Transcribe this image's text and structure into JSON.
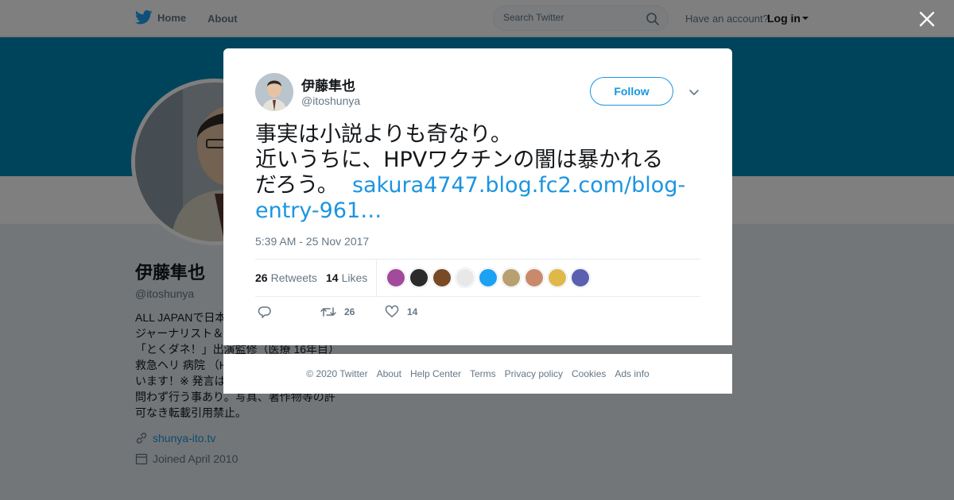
{
  "nav": {
    "home_label": "Home",
    "about_label": "About",
    "search_placeholder": "Search Twitter",
    "account_prompt": "Have an account?",
    "login_label": "Log in"
  },
  "profile": {
    "name": "伊藤隼也",
    "handle": "@itoshunya",
    "bio": "ALL JAPANで日本の医療を変える！医療ジャーナリスト＆写真家。フジテレビ「とくダネ！」出演監修（医療 16年目） 救急ヘリ 病院 （HEM-Net）より……ています！※ 発言は私的呟きでRTは賛否を問わず行う事あり。写真、著作物等の許可なき転載引用禁止。",
    "website": "shunya-ito.tv",
    "joined": "Joined April 2010"
  },
  "tweet": {
    "author_name": "伊藤隼也",
    "author_handle": "@itoshunya",
    "follow_label": "Follow",
    "text_line1": "事実は小説よりも奇なり。",
    "text_line2": "近いうちに、HPVワクチンの闇は暴かれる",
    "text_line3": "だろう。",
    "link_part1": "sakura4747.blog.fc2.com/blog-",
    "link_part2": "entry-961…",
    "timestamp": "5:39 AM - 25 Nov 2017",
    "retweets_count": "26",
    "retweets_label": "Retweets",
    "likes_count": "14",
    "likes_label": "Likes",
    "action_retweet_count": "26",
    "action_like_count": "14",
    "liker_colors": [
      "#a24a9b",
      "#2b2b2b",
      "#7a4a25",
      "#e8e8e8",
      "#1da1f2",
      "#b8a070",
      "#c98a6b",
      "#e0b84a",
      "#5b5fb0"
    ]
  },
  "footer": {
    "items": [
      "© 2020 Twitter",
      "About",
      "Help Center",
      "Terms",
      "Privacy policy",
      "Cookies",
      "Ads info"
    ]
  },
  "colors": {
    "accent": "#1b95e0",
    "banner": "#0088b8",
    "muted": "#657786"
  }
}
